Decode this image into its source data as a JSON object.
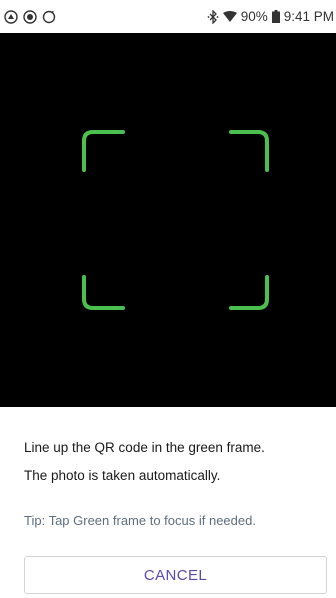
{
  "status_bar": {
    "left_icons": [
      "app-notification-icon",
      "record-icon",
      "circle-icon"
    ],
    "battery": "90%",
    "time": "9:41 PM"
  },
  "scanner": {
    "frame_color": "#4cc04f",
    "background": "#000000"
  },
  "instructions": {
    "line1": "Line up the QR code in the green frame.",
    "line2": "The photo is taken automatically.",
    "tip": "Tip: Tap Green frame to focus if needed."
  },
  "actions": {
    "cancel_label": "CANCEL",
    "accent": "#5a4aa8"
  }
}
